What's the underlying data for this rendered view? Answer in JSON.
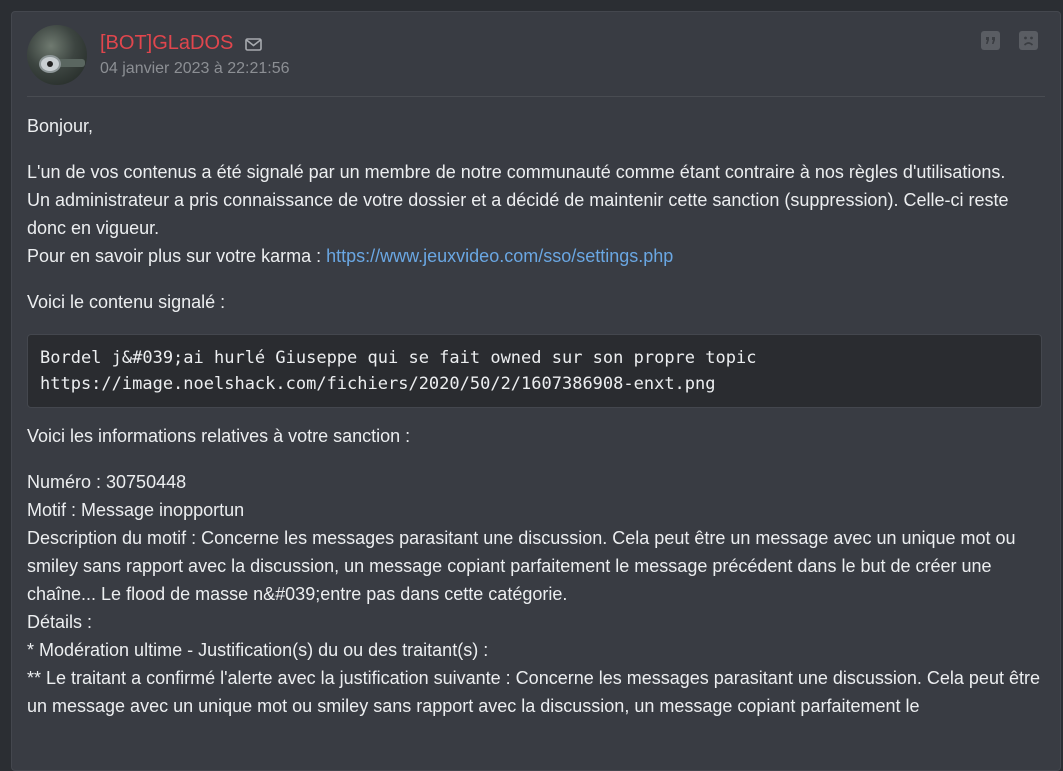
{
  "post": {
    "author": "[BOT]GLaDOS",
    "date": "04 janvier 2023 à 22:21:56",
    "colors": {
      "author": "#e0464d",
      "link": "#6aa7e3",
      "background": "#393c43"
    },
    "icons": [
      "mail-icon",
      "quote-icon",
      "sad-face-icon"
    ],
    "greeting": "Bonjour,",
    "intro_line1": "L'un de vos contenus a été signalé par un membre de notre communauté comme étant contraire à nos règles d'utilisations.",
    "intro_line2": "Un administrateur a pris connaissance de votre dossier et a décidé de maintenir cette sanction (suppression). Celle-ci reste donc en vigueur.",
    "karma_prefix": "Pour en savoir plus sur votre karma : ",
    "karma_link": "https://www.jeuxvideo.com/sso/settings.php",
    "content_heading": "Voici le contenu signalé :",
    "content_line1": "Bordel j&#039;ai hurlé Giuseppe qui se fait owned sur son propre topic",
    "content_line2": "https://image.noelshack.com/fichiers/2020/50/2/1607386908-enxt.png",
    "sanction_heading": "Voici les informations relatives à votre sanction :",
    "numero": "Numéro : 30750448",
    "motif": "Motif : Message inopportun",
    "description": "Description du motif : Concerne les messages parasitant une discussion. Cela peut être un message avec un unique mot ou smiley sans rapport avec la discussion, un message copiant parfaitement le message précédent dans le but de créer une chaîne... Le flood de masse n&#039;entre pas dans cette catégorie.",
    "details": "Détails :",
    "moderation": "* Modération ultime - Justification(s) du ou des traitant(s) :",
    "justification": "** Le traitant a confirmé l'alerte avec la justification suivante : Concerne les messages parasitant une discussion. Cela peut être un message avec un unique mot ou smiley sans rapport avec la discussion, un message copiant parfaitement le"
  }
}
